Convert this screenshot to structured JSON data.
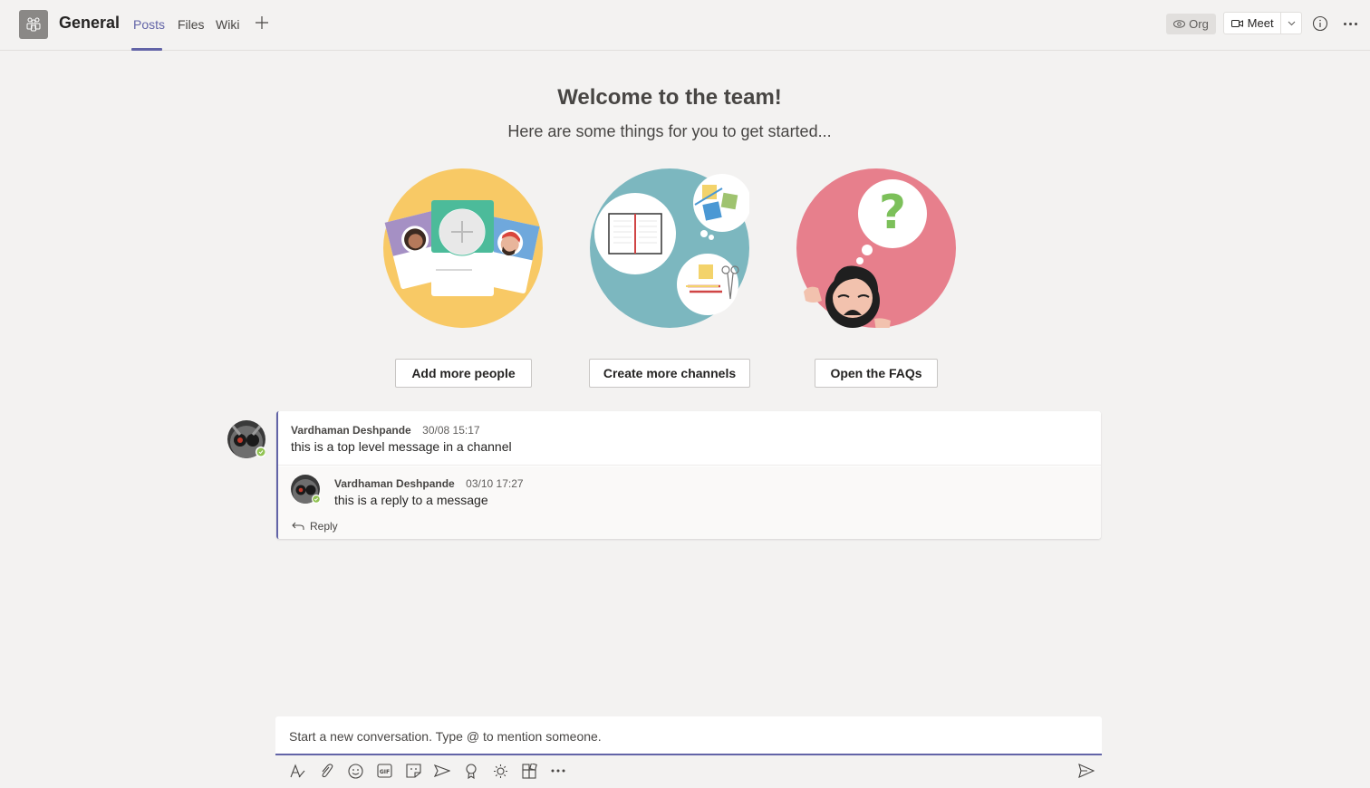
{
  "header": {
    "channel_name": "General",
    "tabs": [
      {
        "label": "Posts",
        "active": true
      },
      {
        "label": "Files",
        "active": false
      },
      {
        "label": "Wiki",
        "active": false
      }
    ],
    "org_label": "Org",
    "meet_label": "Meet",
    "accent_color": "#6264a7"
  },
  "welcome": {
    "title": "Welcome to the team!",
    "subtitle": "Here are some things for you to get started...",
    "actions": [
      {
        "label": "Add more people",
        "illustration": "people-cards",
        "color": "#f8c965"
      },
      {
        "label": "Create more channels",
        "illustration": "channels-notebook",
        "color": "#7cb7bf"
      },
      {
        "label": "Open the FAQs",
        "illustration": "faq-question",
        "color": "#e77f8c"
      }
    ]
  },
  "thread": {
    "top_message": {
      "author": "Vardhaman Deshpande",
      "timestamp": "30/08 15:17",
      "text": "this is a top level message in a channel"
    },
    "reply_message": {
      "author": "Vardhaman Deshpande",
      "timestamp": "03/10 17:27",
      "text": "this is a reply to a message"
    },
    "reply_label": "Reply"
  },
  "compose": {
    "placeholder": "Start a new conversation. Type @ to mention someone.",
    "toolbar_icons": [
      "format-icon",
      "attach-icon",
      "emoji-icon",
      "gif-icon",
      "sticker-icon",
      "meet-now-icon",
      "praise-icon",
      "stream-icon",
      "apps-icon",
      "more-options-icon"
    ]
  }
}
